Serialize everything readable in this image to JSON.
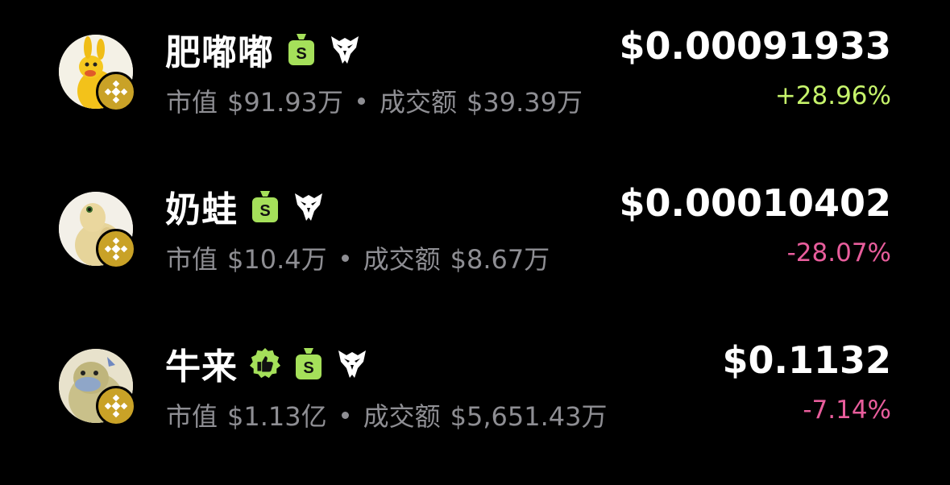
{
  "colors": {
    "up": "#c6f36b",
    "down": "#e85d9c",
    "muted": "#8e8e93",
    "badge_green": "#a5e05a",
    "chain_gold": "#c9a227"
  },
  "tokens": [
    {
      "name": "肥嘟嘟",
      "icons": [
        "money-bag-icon",
        "eagle-icon"
      ],
      "market_cap_label": "市值",
      "market_cap": "$91.93万",
      "volume_label": "成交额",
      "volume": "$39.39万",
      "price": "$0.00091933",
      "change": "+28.96%",
      "direction": "up",
      "chain_icon": "bnb-chain-icon",
      "avatar": "yellow-kangaroo-avatar"
    },
    {
      "name": "奶蛙",
      "icons": [
        "money-bag-icon",
        "eagle-icon"
      ],
      "market_cap_label": "市值",
      "market_cap": "$10.4万",
      "volume_label": "成交额",
      "volume": "$8.67万",
      "price": "$0.00010402",
      "change": "-28.07%",
      "direction": "down",
      "chain_icon": "bnb-chain-icon",
      "avatar": "cream-frog-avatar"
    },
    {
      "name": "牛来",
      "icons": [
        "thumbs-up-badge-icon",
        "money-bag-icon",
        "eagle-icon"
      ],
      "market_cap_label": "市值",
      "market_cap": "$1.13亿",
      "volume_label": "成交额",
      "volume": "$5,651.43万",
      "price": "$0.1132",
      "change": "-7.14%",
      "direction": "down",
      "chain_icon": "bnb-chain-icon",
      "avatar": "masked-frog-avatar"
    }
  ]
}
